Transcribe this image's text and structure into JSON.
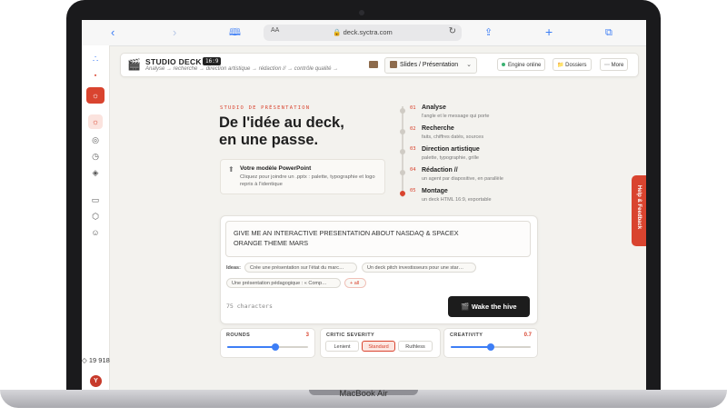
{
  "device": {
    "base_label": "MacBook Air"
  },
  "browser": {
    "url": "deck.syctra.com",
    "text_size_label": "AA",
    "icons": [
      "chevron-left-icon",
      "chevron-right-icon",
      "book-icon",
      "lock-icon",
      "reload-icon",
      "share-icon",
      "plus-icon",
      "tabs-icon"
    ]
  },
  "sidebar": {
    "count": "19 918",
    "avatar_initial": "Y",
    "icons": [
      "logo-icon",
      "flag-icon",
      "sun-icon",
      "sun-icon",
      "compass-icon",
      "history-icon",
      "layers-icon",
      "card-icon",
      "box-icon",
      "users-icon"
    ]
  },
  "header": {
    "title": "STUDIO DECK",
    "ratio": "16:9",
    "breadcrumbs": "Analyse → recherche → direction artistique → rédaction // → contrôle qualité →",
    "mode_select": "Slides / Présentation",
    "engine_label": "Engine online",
    "folders_label": "Dossiers",
    "more_label": "More"
  },
  "hero": {
    "eyebrow": "STUDIO DE PRÉSENTATION",
    "title_line1": "De l'idée au deck,",
    "title_line2": "en une passe."
  },
  "model_card": {
    "title": "Votre modèle PowerPoint",
    "description": "Cliquez pour joindre un .pptx : palette, typographie et logo repris à l'identique"
  },
  "steps": [
    {
      "num": "01",
      "title": "Analyse",
      "sub": "l'angle et le message qui porte"
    },
    {
      "num": "02",
      "title": "Recherche",
      "sub": "faits, chiffres datés, sources"
    },
    {
      "num": "03",
      "title": "Direction artistique",
      "sub": "palette, typographie, grille"
    },
    {
      "num": "04",
      "title": "Rédaction //",
      "sub": "un agent par diapositive, en parallèle"
    },
    {
      "num": "05",
      "title": "Montage",
      "sub": "un deck HTML 16:9, exportable"
    }
  ],
  "prompt": {
    "line1": "GIVE ME AN INTERACTIVE PRESENTATION ABOUT NASDAQ & SPACEX",
    "line2": "ORANGE THEME MARS",
    "ideas_label": "Ideas:",
    "ideas": [
      "Crée une présentation sur l'état du marc…",
      "Un deck pitch investisseurs pour une star…",
      "Une présentation pédagogique : « Comp…",
      "+ all"
    ],
    "char_count": "75 characters",
    "submit_label": "🎬 Wake the hive"
  },
  "params": {
    "rounds": {
      "label": "ROUNDS",
      "value": "3",
      "fraction": 0.6
    },
    "critic": {
      "label": "CRITIC SEVERITY",
      "options": [
        "Lenient",
        "Standard",
        "Ruthless"
      ],
      "selected": "Standard"
    },
    "creativity": {
      "label": "CREATIVITY",
      "value": "0.7",
      "fraction": 0.5
    }
  },
  "feedback_label": "Help & Feedback",
  "colors": {
    "accent": "#d9442f",
    "slider": "#3d7ef6",
    "dark_button": "#1c1c1c"
  }
}
